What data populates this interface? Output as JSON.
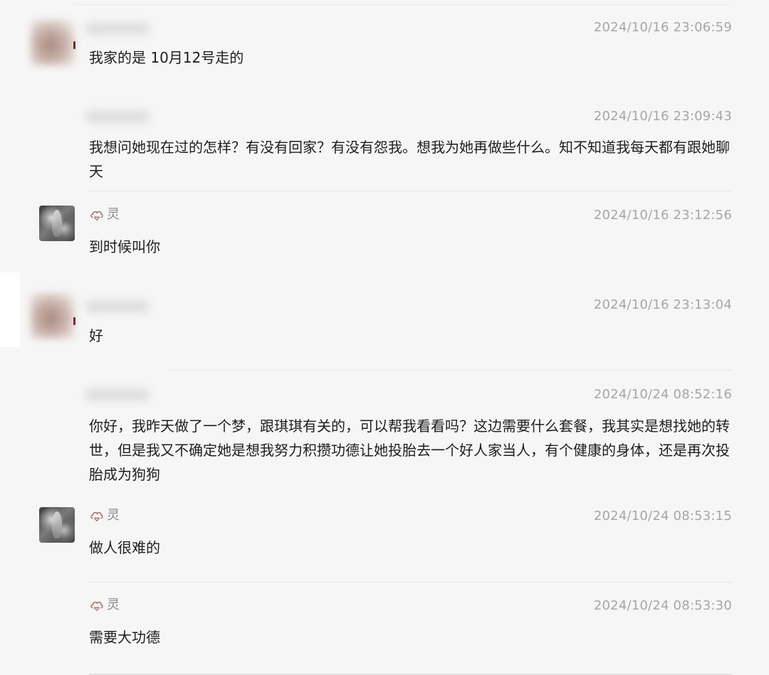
{
  "messages": [
    {
      "sender": "",
      "time": "2024/10/16 23:06:59",
      "text": "我家的是 10月12号走的"
    },
    {
      "sender": "",
      "time": "2024/10/16 23:09:43",
      "text": "我想问她现在过的怎样？有没有回家？有没有怨我。想我为她再做些什么。知不知道我每天都有跟她聊天"
    },
    {
      "sender": "灵",
      "time": "2024/10/16 23:12:56",
      "text": "到时候叫你"
    },
    {
      "sender": "",
      "time": "2024/10/16 23:13:04",
      "text": "好"
    },
    {
      "sender": "",
      "time": "2024/10/24 08:52:16",
      "text": "你好，我昨天做了一个梦，跟琪琪有关的，可以帮我看看吗？这边需要什么套餐，我其实是想找她的转世，但是我又不确定她是想我努力积攒功德让她投胎去一个好人家当人，有个健康的身体，还是再次投胎成为狗狗"
    },
    {
      "sender": "灵",
      "time": "2024/10/24 08:53:15",
      "text": "做人很难的"
    },
    {
      "sender": "灵",
      "time": "2024/10/24 08:53:30",
      "text": "需要大功德"
    }
  ],
  "icons": {
    "sender_badge": "cloud-heart-icon",
    "user_avatar": "blurred-avatar",
    "agent_avatar": "statue-avatar"
  },
  "colors": {
    "accent_icon": "#a8706a",
    "timestamp": "#a6a6a6",
    "background": "#f6f6f6"
  }
}
